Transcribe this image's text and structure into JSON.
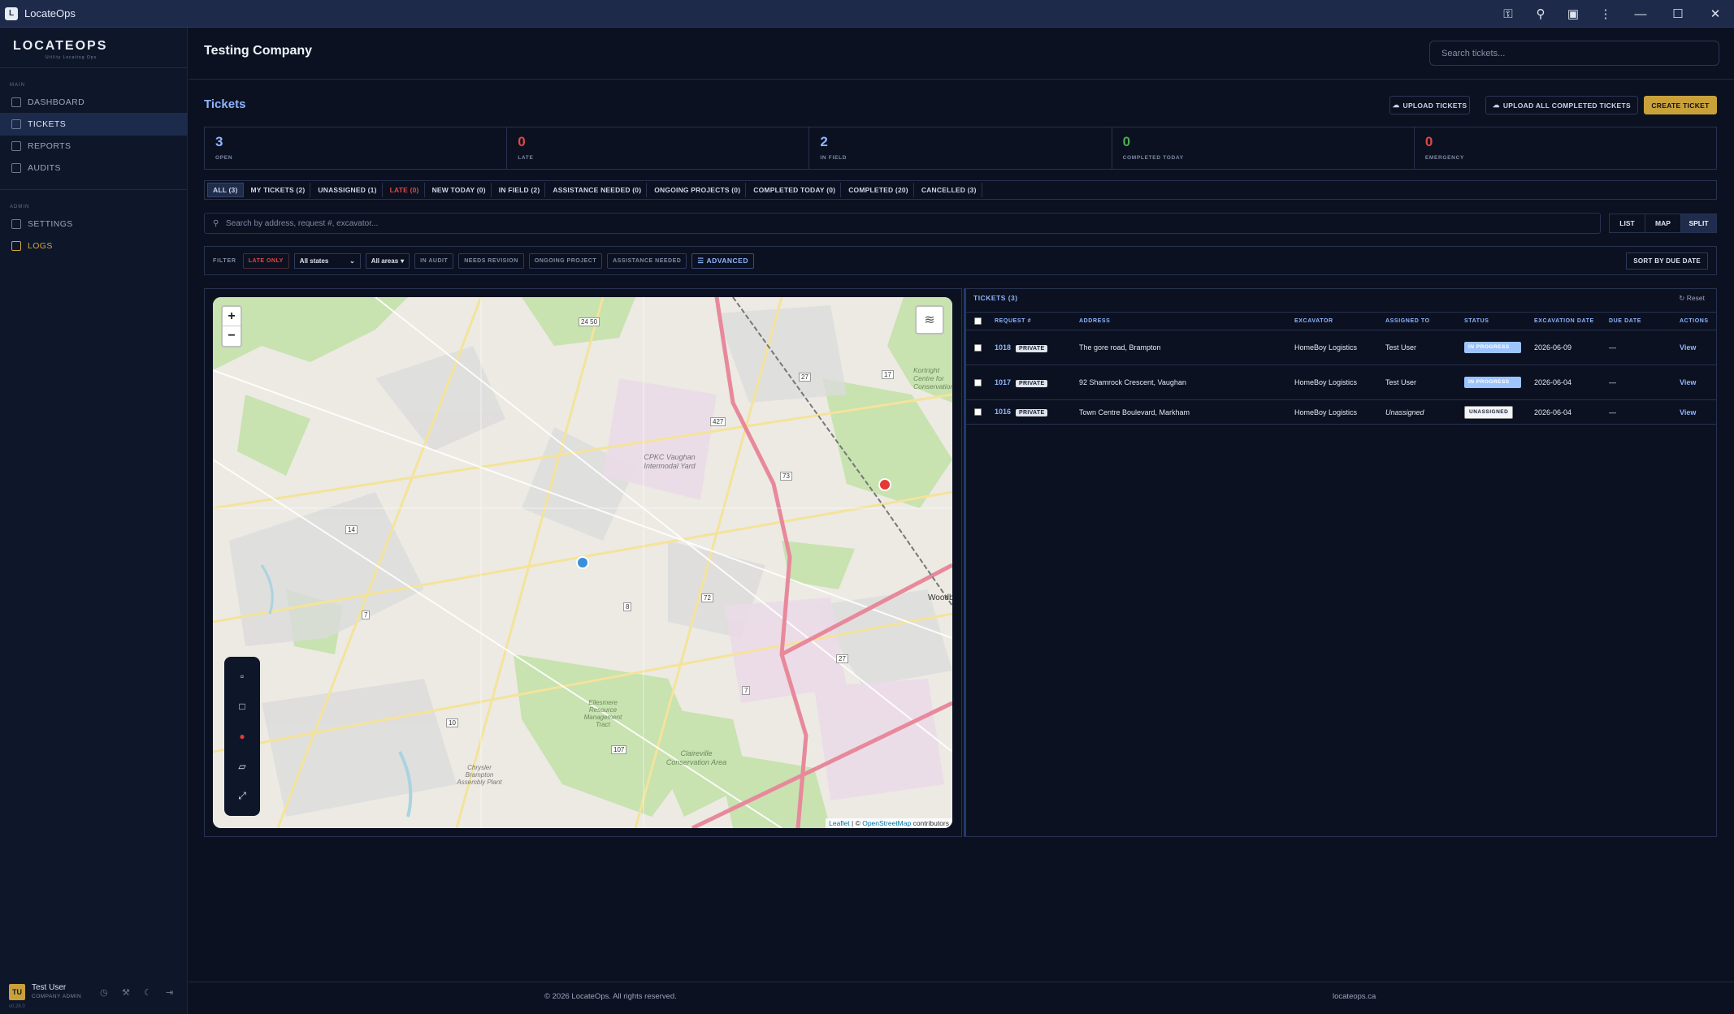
{
  "window": {
    "title": "LocateOps"
  },
  "sidebar": {
    "logo": "LOCATEOPS",
    "logo_sub": "Utility Locating Ops",
    "main_section": "MAIN",
    "admin_section": "ADMIN",
    "items": [
      {
        "label": "DASHBOARD",
        "icon": "dashboard-icon"
      },
      {
        "label": "TICKETS",
        "icon": "ticket-icon"
      },
      {
        "label": "REPORTS",
        "icon": "chart-icon"
      },
      {
        "label": "AUDITS",
        "icon": "clipboard-icon"
      },
      {
        "label": "SETTINGS",
        "icon": "gear-icon"
      },
      {
        "label": "LOGS",
        "icon": "file-icon"
      }
    ],
    "user": {
      "initials": "TU",
      "name": "Test User",
      "role": "COMPANY ADMIN",
      "version": "v0.26.0"
    }
  },
  "header": {
    "company": "Testing Company",
    "search_placeholder": "Search tickets..."
  },
  "page": {
    "title": "Tickets",
    "upload_tickets": "UPLOAD TICKETS",
    "upload_all": "UPLOAD ALL COMPLETED TICKETS",
    "create_ticket": "CREATE TICKET"
  },
  "stats": [
    {
      "value": "3",
      "label": "OPEN",
      "color": "#8fb4ff"
    },
    {
      "value": "0",
      "label": "LATE",
      "color": "#e04848"
    },
    {
      "value": "2",
      "label": "IN FIELD",
      "color": "#8fb4ff"
    },
    {
      "value": "0",
      "label": "COMPLETED TODAY",
      "color": "#4caf50"
    },
    {
      "value": "0",
      "label": "EMERGENCY",
      "color": "#e04848"
    }
  ],
  "tabs": [
    "ALL (3)",
    "MY TICKETS (2)",
    "UNASSIGNED (1)",
    "LATE (0)",
    "NEW TODAY (0)",
    "IN FIELD (2)",
    "ASSISTANCE NEEDED (0)",
    "ONGOING PROJECTS (0)",
    "COMPLETED TODAY (0)",
    "COMPLETED (20)",
    "CANCELLED (3)"
  ],
  "search": {
    "placeholder": "Search by address, request #, excavator..."
  },
  "views": [
    "LIST",
    "MAP",
    "SPLIT"
  ],
  "filters": {
    "label": "FILTER",
    "late_only": "LATE ONLY",
    "states": "All states",
    "areas": "All areas",
    "in_audit": "IN AUDIT",
    "needs_revision": "NEEDS REVISION",
    "ongoing_project": "ONGOING PROJECT",
    "assistance_needed": "ASSISTANCE NEEDED",
    "advanced": "ADVANCED",
    "sort": "SORT BY DUE DATE"
  },
  "map": {
    "zoom_in": "+",
    "zoom_out": "−",
    "attrib_leaflet": "Leaflet",
    "attrib_sep": " | © ",
    "attrib_osm": "OpenStreetMap",
    "attrib_tail": " contributors",
    "labels": [
      "CPKC Vaughan Intermodal Yard",
      "Kortright Centre for Conservation",
      "Claireville Conservation Area",
      "Ellesmere Resource Management Tract",
      "Chrysler Brampton Assembly Plant",
      "Woodbridge"
    ],
    "road_numbers": [
      "24 50",
      "427",
      "27",
      "17",
      "73",
      "14",
      "7",
      "72",
      "8",
      "27",
      "10",
      "107",
      "7"
    ]
  },
  "table": {
    "title": "TICKETS (3)",
    "reset": "Reset",
    "columns": [
      "REQUEST #",
      "ADDRESS",
      "EXCAVATOR",
      "ASSIGNED TO",
      "STATUS",
      "EXCAVATION DATE",
      "DUE DATE",
      "ACTIONS"
    ],
    "rows": [
      {
        "req": "1018",
        "tag": "PRIVATE",
        "address": "The gore road, Brampton",
        "excavator": "HomeBoy Logistics",
        "assigned": "Test User",
        "status": "IN PROGRESS",
        "exc_date": "2026-06-09",
        "due": "—",
        "action": "View"
      },
      {
        "req": "1017",
        "tag": "PRIVATE",
        "address": "92 Shamrock Crescent, Vaughan",
        "excavator": "HomeBoy Logistics",
        "assigned": "Test User",
        "status": "IN PROGRESS",
        "exc_date": "2026-06-04",
        "due": "—",
        "action": "View"
      },
      {
        "req": "1016",
        "tag": "PRIVATE",
        "address": "Town Centre Boulevard, Markham",
        "excavator": "HomeBoy Logistics",
        "assigned": "Unassigned",
        "status": "UNASSIGNED",
        "exc_date": "2026-06-04",
        "due": "—",
        "action": "View"
      }
    ]
  },
  "footer": {
    "copyright": "© 2026 LocateOps. All rights reserved.",
    "site": "locateops.ca"
  }
}
